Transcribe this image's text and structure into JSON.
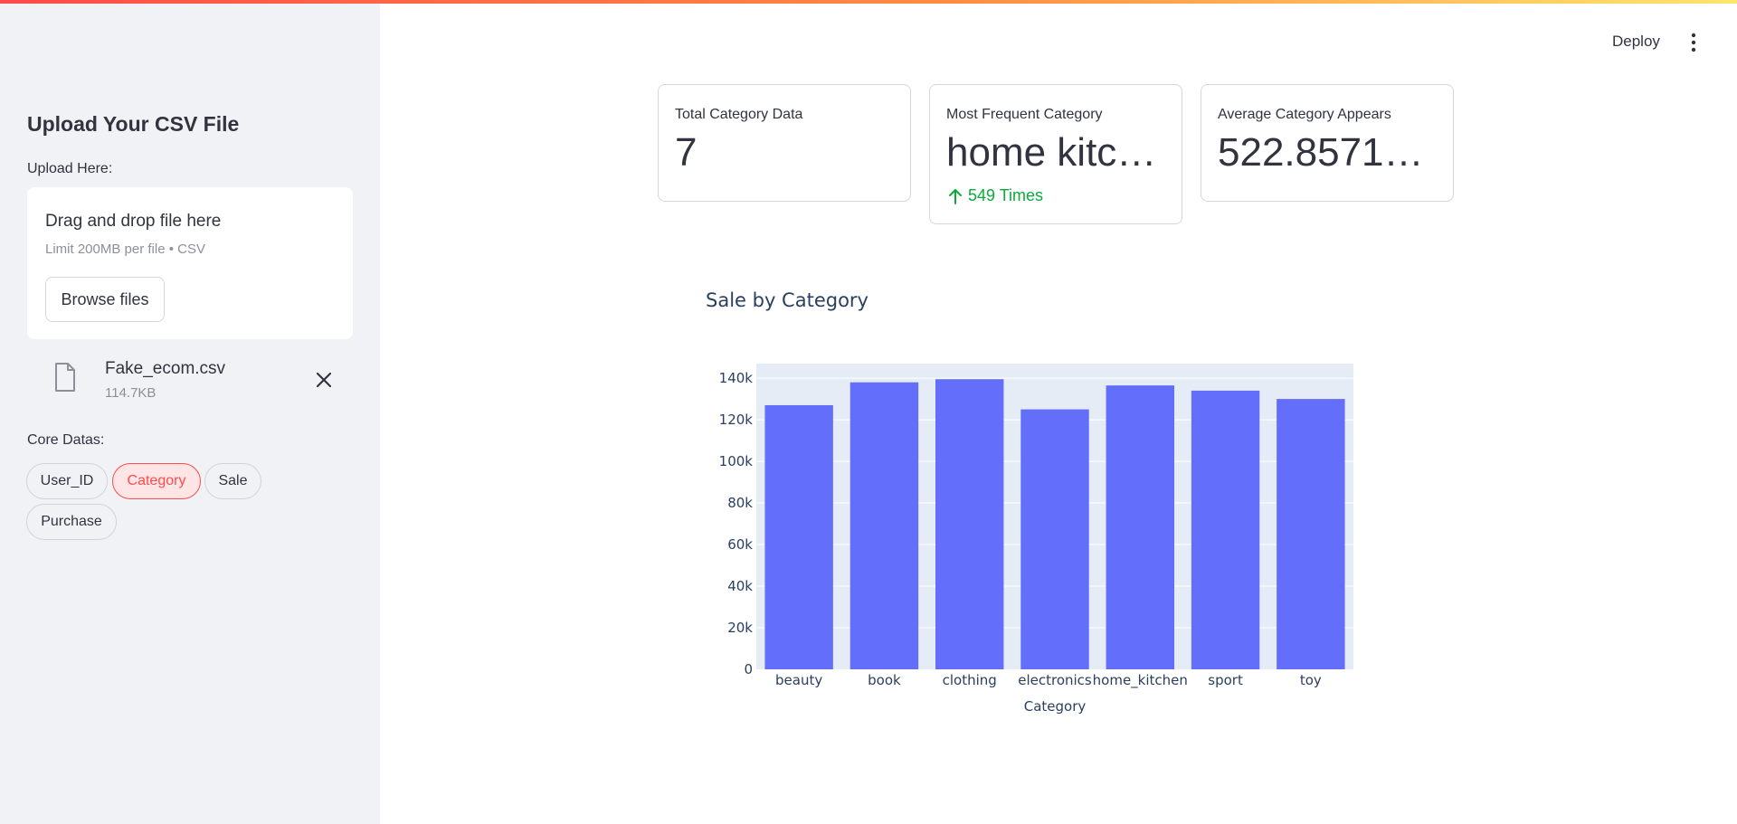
{
  "sidebar": {
    "title": "Upload Your CSV File",
    "upload_label": "Upload Here:",
    "dropzone": {
      "main_text": "Drag and drop file here",
      "sub_text": "Limit 200MB per file • CSV",
      "browse_label": "Browse files"
    },
    "file": {
      "name": "Fake_ecom.csv",
      "size": "114.7KB"
    },
    "core_label": "Core Datas:",
    "pills": [
      {
        "label": "User_ID",
        "active": false
      },
      {
        "label": "Category",
        "active": true
      },
      {
        "label": "Sale",
        "active": false
      },
      {
        "label": "Purchase",
        "active": false
      }
    ]
  },
  "header": {
    "deploy_label": "Deploy"
  },
  "metrics": [
    {
      "label": "Total Category Data",
      "value": "7"
    },
    {
      "label": "Most Frequent Category",
      "value": "home kitc…",
      "delta": "549 Times"
    },
    {
      "label": "Average Category Appears",
      "value": "522.85714…"
    }
  ],
  "colors": {
    "accent": "#ff4b4b",
    "bar": "#636efa",
    "plot_bg": "#e5ecf6",
    "delta_positive": "#09ab3b"
  },
  "chart_data": {
    "type": "bar",
    "title": "Sale by Category",
    "xlabel": "Category",
    "ylabel": "",
    "categories": [
      "beauty",
      "book",
      "clothing",
      "electronics",
      "home_kitchen",
      "sport",
      "toy"
    ],
    "values": [
      127000,
      138000,
      139500,
      125000,
      136500,
      134000,
      130000
    ],
    "ylim": [
      0,
      147000
    ],
    "yticks": [
      0,
      20000,
      40000,
      60000,
      80000,
      100000,
      120000,
      140000
    ],
    "ytick_labels": [
      "0",
      "20k",
      "40k",
      "60k",
      "80k",
      "100k",
      "120k",
      "140k"
    ],
    "grid": true
  }
}
